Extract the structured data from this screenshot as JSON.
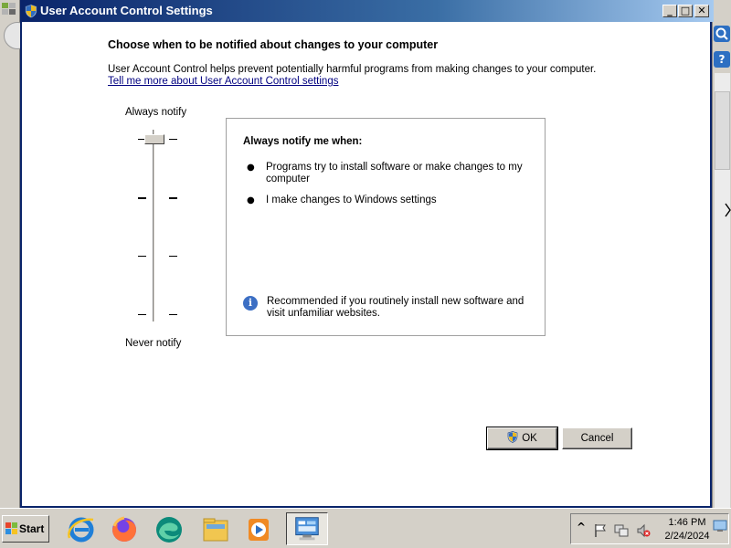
{
  "window": {
    "title": "User Account Control Settings"
  },
  "title_buttons": {
    "minimize": "_",
    "maximize": "□",
    "close": "✕"
  },
  "heading": "Choose when to be notified about changes to your computer",
  "description": "User Account Control helps prevent potentially harmful programs from making changes to your computer.",
  "help_link": "Tell me more about User Account Control settings",
  "slider": {
    "top_label": "Always notify",
    "bottom_label": "Never notify",
    "level": 1,
    "levels": 4
  },
  "info": {
    "title": "Always notify me when:",
    "bullets": [
      "Programs try to install software or make changes to my computer",
      "I make changes to Windows settings"
    ],
    "recommendation": "Recommended if you routinely install new software and visit unfamiliar websites."
  },
  "buttons": {
    "ok": "OK",
    "cancel": "Cancel"
  },
  "taskbar": {
    "start": "Start",
    "apps": [
      "internet-explorer",
      "firefox",
      "edge",
      "file-explorer",
      "media-player",
      "control-panel"
    ]
  },
  "tray": {
    "expand": "^",
    "time": "1:46 PM",
    "date": "2/24/2024"
  },
  "side": {
    "search": "●",
    "help": "?"
  },
  "colors": {
    "title_start": "#0a246a",
    "title_end": "#a6caf0",
    "link": "#000080",
    "info_icon": "#3c6fc4"
  }
}
